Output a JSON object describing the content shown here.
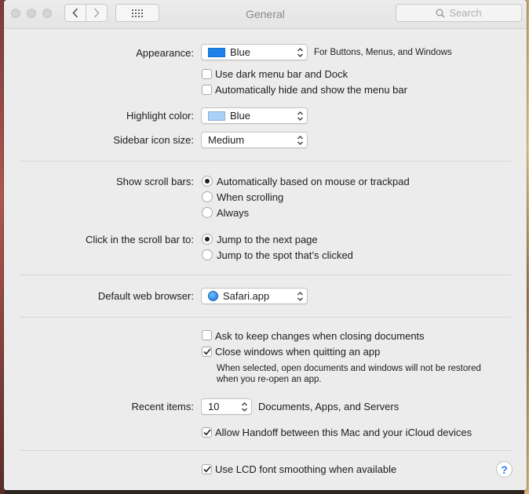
{
  "window": {
    "title": "General"
  },
  "search": {
    "placeholder": "Search"
  },
  "appearance": {
    "label": "Appearance:",
    "value": "Blue",
    "swatch_color": "#1a82e9",
    "hint": "For Buttons, Menus, and Windows"
  },
  "options": {
    "dark_menu": "Use dark menu bar and Dock",
    "auto_hide_menu": "Automatically hide and show the menu bar"
  },
  "highlight": {
    "label": "Highlight color:",
    "value": "Blue",
    "swatch_color": "#a9d0f7"
  },
  "sidebar_icon": {
    "label": "Sidebar icon size:",
    "value": "Medium"
  },
  "scroll_bars": {
    "label": "Show scroll bars:",
    "options": [
      "Automatically based on mouse or trackpad",
      "When scrolling",
      "Always"
    ],
    "selected": 0
  },
  "scroll_click": {
    "label": "Click in the scroll bar to:",
    "options": [
      "Jump to the next page",
      "Jump to the spot that’s clicked"
    ],
    "selected": 0
  },
  "browser": {
    "label": "Default web browser:",
    "value": "Safari.app"
  },
  "documents": {
    "ask_keep_changes": {
      "label": "Ask to keep changes when closing documents",
      "checked": false
    },
    "close_windows": {
      "label": "Close windows when quitting an app",
      "checked": true
    },
    "note_line1": "When selected, open documents and windows will not be restored",
    "note_line2": "when you re-open an app."
  },
  "recent": {
    "label": "Recent items:",
    "value": "10",
    "suffix": "Documents, Apps, and Servers"
  },
  "handoff": {
    "label": "Allow Handoff between this Mac and your iCloud devices",
    "checked": true
  },
  "lcd": {
    "label": "Use LCD font smoothing when available",
    "checked": true
  },
  "help": {
    "glyph": "?"
  }
}
